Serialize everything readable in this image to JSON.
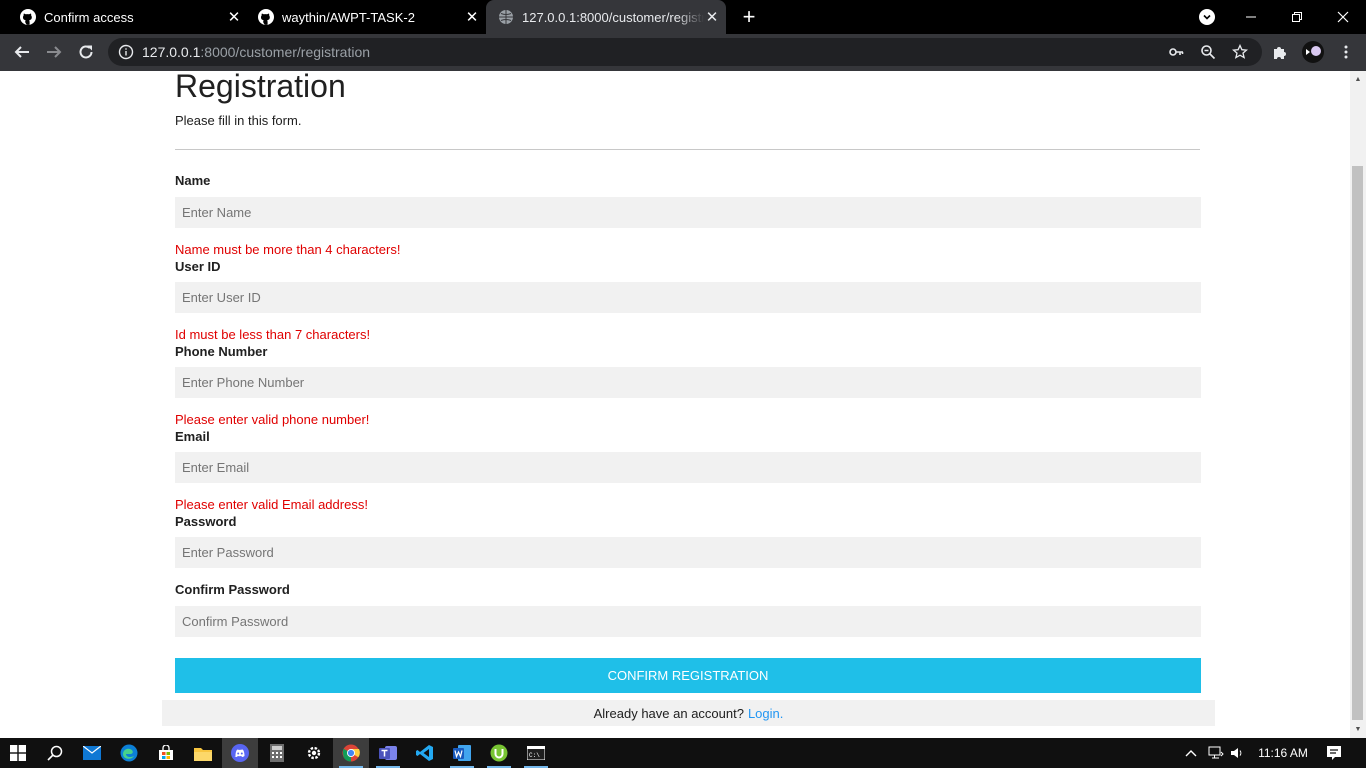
{
  "browser": {
    "tabs": [
      {
        "title": "Confirm access",
        "favicon": "github-icon",
        "active": false
      },
      {
        "title": "waythin/AWPT-TASK-2",
        "favicon": "github-icon",
        "active": false
      },
      {
        "title": "127.0.0.1:8000/customer/registration",
        "favicon": "globe-icon",
        "active": true
      }
    ],
    "url_host": "127.0.0.1",
    "url_rest": ":8000/customer/registration"
  },
  "page": {
    "title": "Registration",
    "subtitle": "Please fill in this form.",
    "fields": [
      {
        "label": "Name",
        "placeholder": "Enter Name",
        "error": "Name must be more than 4 characters!"
      },
      {
        "label": "User ID",
        "placeholder": "Enter User ID",
        "error": "Id must be less than 7 characters!"
      },
      {
        "label": "Phone Number",
        "placeholder": "Enter Phone Number",
        "error": "Please enter valid phone number!"
      },
      {
        "label": "Email",
        "placeholder": "Enter Email",
        "error": "Please enter valid Email address!"
      },
      {
        "label": "Password",
        "placeholder": "Enter Password",
        "error": ""
      },
      {
        "label": "Confirm Password",
        "placeholder": "Confirm Password",
        "error": ""
      }
    ],
    "submit_label": "Confirm Registration",
    "login_prompt": "Already have an account?",
    "login_link": "Login."
  },
  "taskbar": {
    "apps": [
      "windows-start-icon",
      "search-icon",
      "mail-icon",
      "edge-icon",
      "store-icon",
      "file-explorer-icon",
      "discord-icon",
      "calculator-icon",
      "settings-icon",
      "chrome-icon",
      "teams-icon",
      "vscode-icon",
      "word-icon",
      "utorrent-icon",
      "terminal-icon"
    ],
    "time": "11:16 AM"
  },
  "colors": {
    "accent": "#1fbfe8",
    "error": "#e00000",
    "link": "#2196f3",
    "field_bg": "#f1f1f1"
  }
}
